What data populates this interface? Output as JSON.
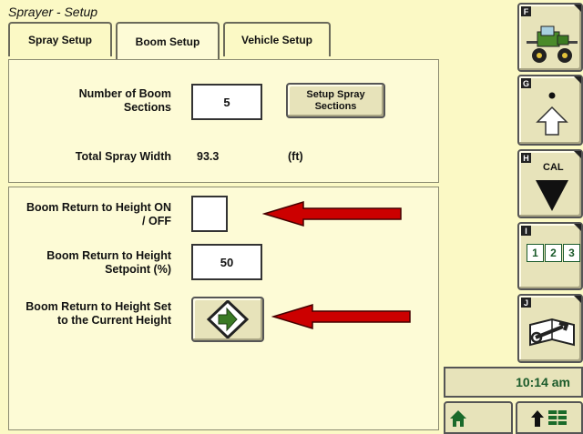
{
  "window": {
    "title": "Sprayer - Setup"
  },
  "tabs": [
    {
      "label": "Spray Setup"
    },
    {
      "label": "Boom Setup",
      "active": true
    },
    {
      "label": "Vehicle Setup"
    }
  ],
  "boom": {
    "sections_label": "Number of Boom Sections",
    "sections_value": "5",
    "setup_button": "Setup Spray Sections",
    "width_label": "Total Spray Width",
    "width_value": "93.3",
    "width_unit": "(ft)"
  },
  "height": {
    "onoff_label": "Boom Return to Height ON / OFF",
    "setpoint_label": "Boom Return to Height Setpoint (%)",
    "setpoint_value": "50",
    "current_label": "Boom Return to Height Set to the Current Height"
  },
  "softkeys": [
    {
      "letter": "F",
      "icon": "sprayer-vehicle-icon"
    },
    {
      "letter": "G",
      "icon": "shift-up-arrow-icon"
    },
    {
      "letter": "H",
      "label": "CAL",
      "icon": "down-triangle-icon"
    },
    {
      "letter": "I",
      "icon": "numbered-boxes-icon",
      "digits": [
        "1",
        "2",
        "3"
      ]
    },
    {
      "letter": "J",
      "icon": "manual-wrench-icon"
    }
  ],
  "status": {
    "clock": "10:14 am"
  },
  "colors": {
    "accent_red": "#cc0000",
    "arrow_green": "#3a7a25",
    "background": "#fbf9c5"
  }
}
